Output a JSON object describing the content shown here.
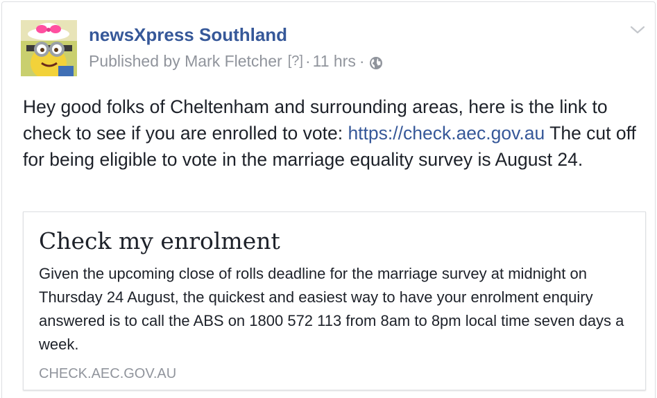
{
  "post": {
    "page_name": "newsXpress Southland",
    "meta": {
      "published_by": "Published by Mark Fletcher",
      "help_marker": "[?]",
      "separator": "·",
      "time": "11 hrs",
      "audience_icon": "globe-icon"
    },
    "menu_icon": "chevron-down-icon",
    "body": {
      "text_before_link": "Hey good folks of Cheltenham and surrounding areas, here is the link to check to see if you are enrolled to vote: ",
      "link": "https://check.aec.gov.au",
      "text_after_link": " The cut off for being eligible to vote in the marriage equality survey is August 24."
    },
    "link_card": {
      "title": "Check my enrolment",
      "description": "Given the upcoming close of rolls deadline for the marriage survey at midnight on Thursday 24 August, the quickest and easiest way to have your enrolment enquiry answered is to call the ABS on 1800 572 113 from 8am to 8pm local time seven days a week.",
      "domain": "CHECK.AEC.GOV.AU"
    }
  },
  "colors": {
    "link": "#365899",
    "meta": "#90949c",
    "text": "#1d2129",
    "border": "#dddfe2"
  }
}
